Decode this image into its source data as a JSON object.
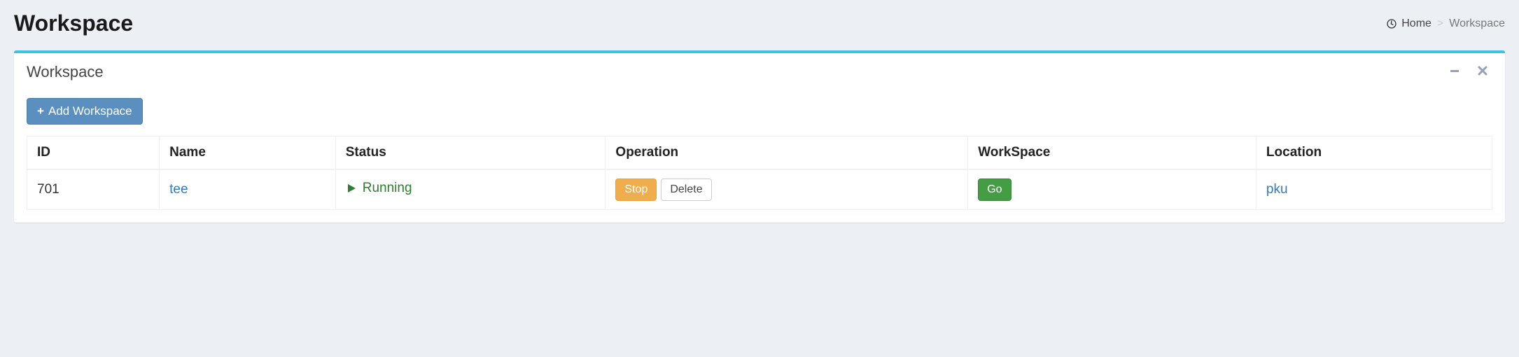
{
  "header": {
    "title": "Workspace",
    "breadcrumb": {
      "home": "Home",
      "current": "Workspace"
    }
  },
  "box": {
    "title": "Workspace"
  },
  "toolbar": {
    "add_workspace_label": "Add Workspace"
  },
  "table": {
    "headers": {
      "id": "ID",
      "name": "Name",
      "status": "Status",
      "operation": "Operation",
      "workspace": "WorkSpace",
      "location": "Location"
    },
    "rows": [
      {
        "id": "701",
        "name": "tee",
        "status": "Running",
        "op_stop": "Stop",
        "op_delete": "Delete",
        "workspace_go": "Go",
        "location": "pku"
      }
    ]
  }
}
